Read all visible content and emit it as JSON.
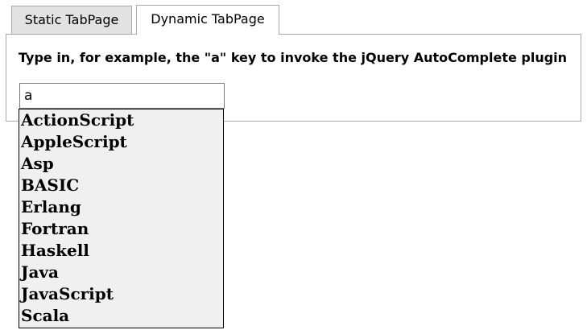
{
  "tabs": [
    {
      "label": "Static TabPage",
      "active": false
    },
    {
      "label": "Dynamic TabPage",
      "active": true
    }
  ],
  "panel": {
    "instruction": "Type in, for example, the \"a\" key to invoke the jQuery AutoComplete plugin",
    "input_value": "a"
  },
  "suggestions": [
    "ActionScript",
    "AppleScript",
    "Asp",
    "BASIC",
    "Erlang",
    "Fortran",
    "Haskell",
    "Java",
    "JavaScript",
    "Scala"
  ]
}
